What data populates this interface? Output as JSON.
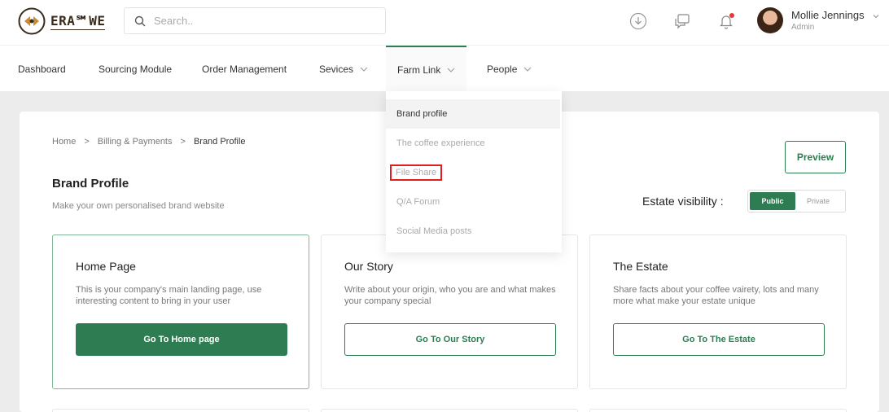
{
  "brand": {
    "logo_text": "ERA℠WE",
    "logo_icon": "coffee-bean-logo-icon"
  },
  "search": {
    "placeholder": "Search..",
    "icon": "search-icon"
  },
  "header_icons": [
    "download-icon",
    "chat-icon",
    "bell-icon"
  ],
  "user": {
    "name": "Mollie Jennings",
    "role": "Admin"
  },
  "nav": {
    "items": [
      {
        "label": "Dashboard"
      },
      {
        "label": "Sourcing Module"
      },
      {
        "label": "Order Management"
      },
      {
        "label": "Sevices"
      },
      {
        "label": "Farm Link"
      },
      {
        "label": "People"
      }
    ]
  },
  "dropdown": {
    "items": [
      {
        "label": "Brand profile"
      },
      {
        "label": "The coffee experience"
      },
      {
        "label": "File Share"
      },
      {
        "label": "Q/A Forum"
      },
      {
        "label": "Social Media posts"
      }
    ]
  },
  "breadcrumb": {
    "items": [
      "Home",
      "Billing & Payments",
      "Brand Profile"
    ],
    "separator": ">"
  },
  "page": {
    "title": "Brand Profile",
    "subtitle": "Make your own personalised brand website",
    "preview_label": "Preview",
    "visibility_label": "Estate visibility :",
    "visibility_options": [
      "Public",
      "Private"
    ]
  },
  "tiles": [
    {
      "title": "Home Page",
      "description": "This is your company's main landing page, use interesting content to bring in your user",
      "button": "Go To Home page"
    },
    {
      "title": "Our Story",
      "description": "Write about your origin, who you are and what makes your company special",
      "button": "Go To Our Story"
    },
    {
      "title": "The Estate",
      "description": "Share facts about your coffee vairety, lots and many more what make your estate unique",
      "button": "Go To The Estate"
    }
  ],
  "colors": {
    "accent": "#2e7d52",
    "highlight_box": "#e01e1e",
    "page_bg": "#ececec"
  }
}
